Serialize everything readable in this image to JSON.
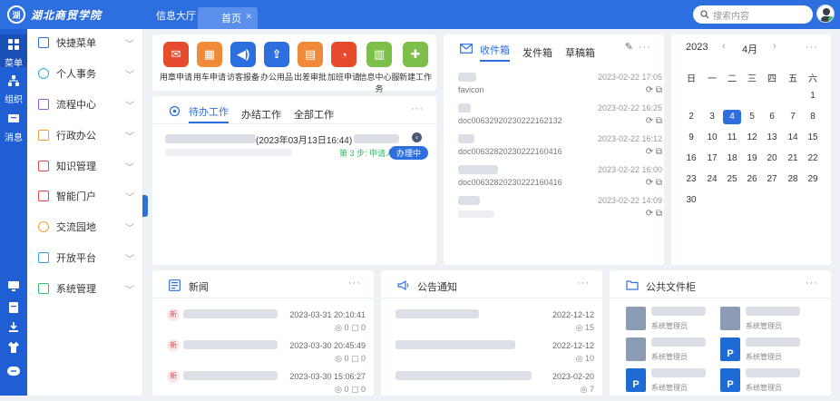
{
  "topbar": {
    "logo_text": "湖北商贸学院",
    "nav_hall": "信息大厅",
    "tab_home": "首页",
    "search_placeholder": "搜索内容"
  },
  "rail": {
    "items": [
      {
        "label": "菜单"
      },
      {
        "label": "组织"
      },
      {
        "label": "消息"
      }
    ]
  },
  "sidemenu": {
    "items": [
      {
        "label": "快捷菜单",
        "icon": "grid-icon",
        "color": "#2e6fe0"
      },
      {
        "label": "个人事务",
        "icon": "user-icon",
        "color": "#2ea8e6"
      },
      {
        "label": "流程中心",
        "icon": "flow-icon",
        "color": "#9b59d6"
      },
      {
        "label": "行政办公",
        "icon": "briefcase-icon",
        "color": "#f0a030"
      },
      {
        "label": "知识管理",
        "icon": "book-icon",
        "color": "#e64b4b"
      },
      {
        "label": "智能门户",
        "icon": "portal-icon",
        "color": "#e64b4b"
      },
      {
        "label": "交流园地",
        "icon": "hand-icon",
        "color": "#f0a030"
      },
      {
        "label": "开放平台",
        "icon": "cube-icon",
        "color": "#2ea8e6"
      },
      {
        "label": "系统管理",
        "icon": "settings-icon",
        "color": "#2ec26a"
      }
    ]
  },
  "quick_actions": [
    {
      "label": "用章申请",
      "color": "#e64b2e"
    },
    {
      "label": "用车申请",
      "color": "#f08a3a"
    },
    {
      "label": "访客报备",
      "color": "#2e6fe0"
    },
    {
      "label": "办公用品",
      "color": "#2e6fe0"
    },
    {
      "label": "出差审批",
      "color": "#f08a3a"
    },
    {
      "label": "加班申请",
      "color": "#e64b2e"
    },
    {
      "label": "信息中心服务",
      "color": "#7cc04a"
    },
    {
      "label": "新建工作",
      "color": "#7cc04a"
    }
  ],
  "work": {
    "tabs": [
      "待办工作",
      "办结工作",
      "全部工作"
    ],
    "item_time": "(2023年03月13日16:44)",
    "item_step": "第 3 步: 申请人",
    "item_button": "办理中"
  },
  "mail": {
    "tabs": [
      "收件箱",
      "发件箱",
      "草稿箱"
    ],
    "rows": [
      {
        "date": "2023-02-22 17:05",
        "sub": "favicon"
      },
      {
        "date": "2023-02-22 16:25",
        "sub": "doc0063292023022216213​2"
      },
      {
        "date": "2023-02-22 16:12",
        "sub": "doc006328202302221604​16"
      },
      {
        "date": "2023-02-22 16:00",
        "sub": "doc006328202302221604​16"
      },
      {
        "date": "2023-02-22 14:09",
        "sub": ""
      }
    ]
  },
  "calendar": {
    "year": "2023",
    "month": "4月",
    "weekdays": [
      "日",
      "一",
      "二",
      "三",
      "四",
      "五",
      "六"
    ],
    "days": [
      "",
      "",
      "",
      "",
      "",
      "",
      "1",
      "2",
      "3",
      "4",
      "5",
      "6",
      "7",
      "8",
      "9",
      "10",
      "11",
      "12",
      "13",
      "14",
      "15",
      "16",
      "17",
      "18",
      "19",
      "20",
      "21",
      "22",
      "23",
      "24",
      "25",
      "26",
      "27",
      "28",
      "29",
      "30"
    ],
    "today": "4"
  },
  "news": {
    "title": "新闻",
    "tag": "新",
    "rows": [
      {
        "date": "2023-03-31 20:10:41",
        "stat": "◎ 0 ▢ 0"
      },
      {
        "date": "2023-03-30 20:45:49",
        "stat": "◎ 0 ▢ 0"
      },
      {
        "date": "2023-03-30 15:06:27",
        "stat": "◎ 0 ▢ 0"
      }
    ]
  },
  "notice": {
    "title": "公告通知",
    "rows": [
      {
        "date": "2022-12-12",
        "stat": "◎ 15"
      },
      {
        "date": "2022-12-12",
        "stat": "◎ 10"
      },
      {
        "date": "2023-02-20",
        "stat": "◎ 7"
      }
    ]
  },
  "files": {
    "title": "公共文件柜",
    "owner": "系统管理员",
    "items": [
      {
        "type": "doc"
      },
      {
        "type": "doc"
      },
      {
        "type": "doc"
      },
      {
        "type": "p"
      },
      {
        "type": "p"
      },
      {
        "type": "p"
      }
    ]
  }
}
